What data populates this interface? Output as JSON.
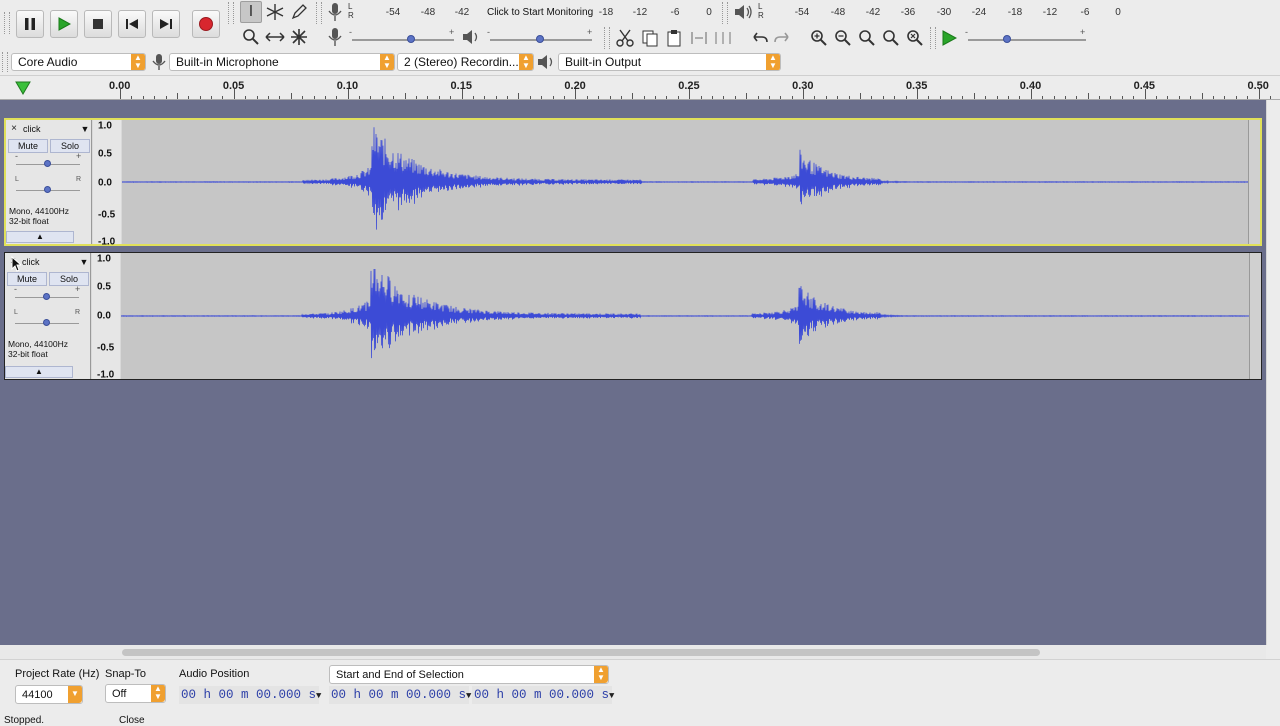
{
  "colors": {
    "accent": "#f0a030",
    "waveform": "#3c4bd6",
    "record": "#d8262e",
    "play": "#2aa52a",
    "workspace": "#6a6e8b"
  },
  "transport": {
    "pause_icon": "pause-icon",
    "play_icon": "play-icon",
    "stop_icon": "stop-icon",
    "skip_start_icon": "skip-to-start-icon",
    "skip_end_icon": "skip-to-end-icon",
    "record_icon": "record-icon"
  },
  "meters": {
    "record": {
      "ticks": [
        "-54",
        "-48",
        "-42",
        "-18",
        "-12",
        "-6",
        "0"
      ],
      "hint": "Click to Start Monitoring",
      "l": "L",
      "r": "R"
    },
    "playback": {
      "ticks": [
        "-54",
        "-48",
        "-42",
        "-36",
        "-30",
        "-24",
        "-18",
        "-12",
        "-6",
        "0"
      ],
      "l": "L",
      "r": "R"
    }
  },
  "mixer": {
    "minus": "-",
    "plus": "+"
  },
  "device_toolbar": {
    "host": "Core Audio",
    "input": "Built-in Microphone",
    "channels": "2 (Stereo) Recordin...",
    "output": "Built-in Output"
  },
  "ruler": {
    "labels": [
      "0.00",
      "0.05",
      "0.10",
      "0.15",
      "0.20",
      "0.25",
      "0.30",
      "0.35",
      "0.40",
      "0.45",
      "0.50"
    ]
  },
  "tracks": [
    {
      "name": "click",
      "close": "×",
      "menu": "▼",
      "mute": "Mute",
      "solo": "Solo",
      "gain_minus": "-",
      "gain_plus": "+",
      "pan_l": "L",
      "pan_r": "R",
      "info1": "Mono, 44100Hz",
      "info2": "32-bit float",
      "collapse": "▲",
      "scale": [
        "1.0",
        "0.5",
        "0.0",
        "-0.5",
        "-1.0"
      ],
      "selected": true
    },
    {
      "name": "click",
      "close": "×",
      "menu": "▼",
      "mute": "Mute",
      "solo": "Solo",
      "gain_minus": "-",
      "gain_plus": "+",
      "pan_l": "L",
      "pan_r": "R",
      "info1": "Mono, 44100Hz",
      "info2": "32-bit float",
      "collapse": "▲",
      "scale": [
        "1.0",
        "0.5",
        "0.0",
        "-0.5",
        "-1.0"
      ],
      "selected": false
    }
  ],
  "bottom": {
    "project_rate_label": "Project Rate (Hz)",
    "project_rate_value": "44100",
    "snap_label": "Snap-To",
    "snap_value": "Off",
    "audio_position_label": "Audio Position",
    "audio_position_value": "00 h 00 m 00.000 s",
    "selection_mode": "Start and End of Selection",
    "selection_start": "00 h 00 m 00.000 s",
    "selection_end": "00 h 00 m 00.000 s",
    "status": "Stopped.",
    "status2": "Close"
  }
}
